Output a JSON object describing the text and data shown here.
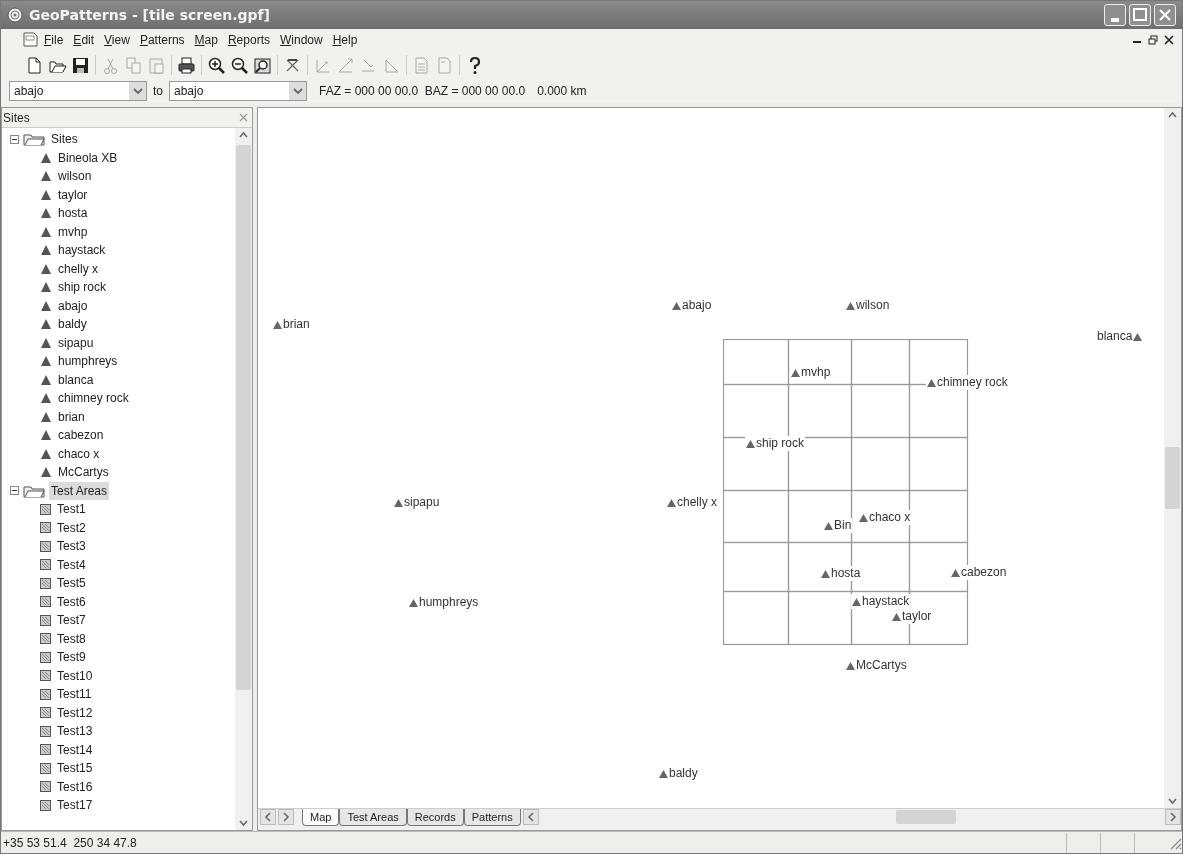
{
  "window": {
    "title": "GeoPatterns - [tile screen.gpf]"
  },
  "menu": [
    "File",
    "Edit",
    "View",
    "Patterns",
    "Map",
    "Reports",
    "Window",
    "Help"
  ],
  "toolbar": [
    {
      "kind": "new",
      "disabled": false
    },
    {
      "kind": "open",
      "disabled": false
    },
    {
      "kind": "save",
      "disabled": false
    },
    {
      "kind": "separator"
    },
    {
      "kind": "cut",
      "disabled": true
    },
    {
      "kind": "copy",
      "disabled": true
    },
    {
      "kind": "paste",
      "disabled": true
    },
    {
      "kind": "separator"
    },
    {
      "kind": "print",
      "disabled": false
    },
    {
      "kind": "separator"
    },
    {
      "kind": "zoomin",
      "disabled": false
    },
    {
      "kind": "zoomout",
      "disabled": false
    },
    {
      "kind": "zoombox",
      "disabled": false
    },
    {
      "kind": "separator"
    },
    {
      "kind": "marker",
      "disabled": false
    },
    {
      "kind": "separator"
    },
    {
      "kind": "linea",
      "disabled": true
    },
    {
      "kind": "lineb",
      "disabled": true
    },
    {
      "kind": "linec",
      "disabled": true
    },
    {
      "kind": "lined",
      "disabled": true
    },
    {
      "kind": "separator"
    },
    {
      "kind": "pagea",
      "disabled": true
    },
    {
      "kind": "pageb",
      "disabled": true
    },
    {
      "kind": "separator"
    },
    {
      "kind": "help",
      "disabled": false
    }
  ],
  "route": {
    "from": "abajo",
    "to_label": "to",
    "to": "abajo",
    "bearings": "FAZ = 000 00 00.0  BAZ = 000 00 00.0",
    "distance": "0.000 km"
  },
  "sidebar": {
    "title": "Sites",
    "tree": [
      {
        "label": "Sites",
        "kind": "folder",
        "expanded": true,
        "selected": false,
        "children": [
          {
            "label": "Bineola XB",
            "kind": "site",
            "selected": false
          },
          {
            "label": "wilson",
            "kind": "site",
            "selected": false
          },
          {
            "label": "taylor",
            "kind": "site",
            "selected": false
          },
          {
            "label": "hosta",
            "kind": "site",
            "selected": false
          },
          {
            "label": "mvhp",
            "kind": "site",
            "selected": false
          },
          {
            "label": "haystack",
            "kind": "site",
            "selected": false
          },
          {
            "label": "chelly x",
            "kind": "site",
            "selected": false
          },
          {
            "label": "ship rock",
            "kind": "site",
            "selected": false
          },
          {
            "label": "abajo",
            "kind": "site",
            "selected": false
          },
          {
            "label": "baldy",
            "kind": "site",
            "selected": false
          },
          {
            "label": "sipapu",
            "kind": "site",
            "selected": false
          },
          {
            "label": "humphreys",
            "kind": "site",
            "selected": false
          },
          {
            "label": "blanca",
            "kind": "site",
            "selected": false
          },
          {
            "label": "chimney rock",
            "kind": "site",
            "selected": false
          },
          {
            "label": "brian",
            "kind": "site",
            "selected": false
          },
          {
            "label": "cabezon",
            "kind": "site",
            "selected": false
          },
          {
            "label": "chaco x",
            "kind": "site",
            "selected": false
          },
          {
            "label": "McCartys",
            "kind": "site",
            "selected": false
          }
        ]
      },
      {
        "label": "Test Areas",
        "kind": "folder",
        "expanded": true,
        "selected": true,
        "children": [
          {
            "label": "Test1",
            "kind": "area",
            "selected": false
          },
          {
            "label": "Test2",
            "kind": "area",
            "selected": false
          },
          {
            "label": "Test3",
            "kind": "area",
            "selected": false
          },
          {
            "label": "Test4",
            "kind": "area",
            "selected": false
          },
          {
            "label": "Test5",
            "kind": "area",
            "selected": false
          },
          {
            "label": "Test6",
            "kind": "area",
            "selected": false
          },
          {
            "label": "Test7",
            "kind": "area",
            "selected": false
          },
          {
            "label": "Test8",
            "kind": "area",
            "selected": false
          },
          {
            "label": "Test9",
            "kind": "area",
            "selected": false
          },
          {
            "label": "Test10",
            "kind": "area",
            "selected": false
          },
          {
            "label": "Test11",
            "kind": "area",
            "selected": false
          },
          {
            "label": "Test12",
            "kind": "area",
            "selected": false
          },
          {
            "label": "Test13",
            "kind": "area",
            "selected": false
          },
          {
            "label": "Test14",
            "kind": "area",
            "selected": false
          },
          {
            "label": "Test15",
            "kind": "area",
            "selected": false
          },
          {
            "label": "Test16",
            "kind": "area",
            "selected": false
          },
          {
            "label": "Test17",
            "kind": "area",
            "selected": false
          }
        ]
      }
    ]
  },
  "map": {
    "sites": [
      {
        "label": "abajo",
        "kind": "marker_before"
      },
      {
        "label": "wilson",
        "kind": "marker_before"
      },
      {
        "label": "brian",
        "kind": "marker_before"
      },
      {
        "label": "blanca",
        "kind": "marker_after"
      },
      {
        "label": "mvhp",
        "kind": "marker_before"
      },
      {
        "label": "chimney rock",
        "kind": "marker_before"
      },
      {
        "label": "ship rock",
        "kind": "marker_before"
      },
      {
        "label": "sipapu",
        "kind": "marker_before"
      },
      {
        "label": "chelly x",
        "kind": "marker_before"
      },
      {
        "label": "Bin",
        "kind": "marker_before"
      },
      {
        "label": "chaco x",
        "kind": "marker_before"
      },
      {
        "label": "hosta",
        "kind": "marker_before"
      },
      {
        "label": "cabezon",
        "kind": "marker_before"
      },
      {
        "label": "humphreys",
        "kind": "marker_before"
      },
      {
        "label": "haystack",
        "kind": "marker_before"
      },
      {
        "label": "taylor",
        "kind": "marker_before"
      },
      {
        "label": "McCartys",
        "kind": "marker_before"
      },
      {
        "label": "baldy",
        "kind": "marker_before"
      }
    ]
  },
  "tabs": [
    {
      "label": "Map",
      "selected": true
    },
    {
      "label": "Test Areas",
      "selected": false
    },
    {
      "label": "Records",
      "selected": false
    },
    {
      "label": "Patterns",
      "selected": false
    }
  ],
  "status_bar": {
    "coordinates": "+35 53 51.4  250 34 47.8"
  }
}
